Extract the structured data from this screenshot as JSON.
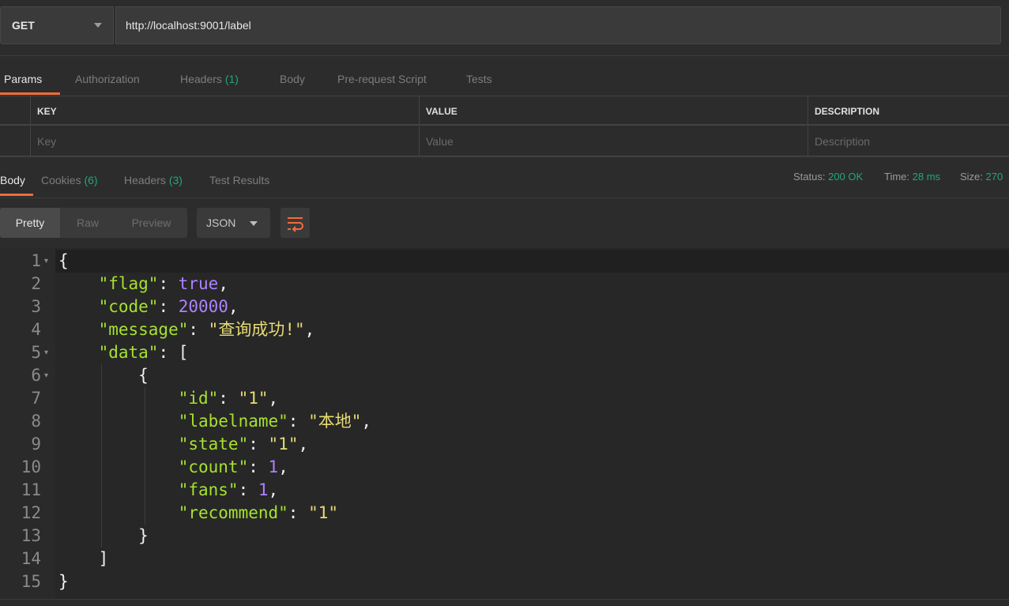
{
  "request": {
    "method": "GET",
    "url": "http://localhost:9001/label"
  },
  "request_tabs": [
    {
      "label": "Params",
      "count": ""
    },
    {
      "label": "Authorization",
      "count": ""
    },
    {
      "label": "Headers",
      "count": "(1)"
    },
    {
      "label": "Body",
      "count": ""
    },
    {
      "label": "Pre-request Script",
      "count": ""
    },
    {
      "label": "Tests",
      "count": ""
    }
  ],
  "params_table": {
    "headers": [
      "KEY",
      "VALUE",
      "DESCRIPTION"
    ],
    "placeholders": [
      "Key",
      "Value",
      "Description"
    ]
  },
  "response_tabs": [
    {
      "label": "Body",
      "count": ""
    },
    {
      "label": "Cookies",
      "count": "(6)"
    },
    {
      "label": "Headers",
      "count": "(3)"
    },
    {
      "label": "Test Results",
      "count": ""
    }
  ],
  "status": {
    "status_label": "Status:",
    "status_value": "200 OK",
    "time_label": "Time:",
    "time_value": "28 ms",
    "size_label": "Size:",
    "size_value": "270"
  },
  "view_modes": [
    "Pretty",
    "Raw",
    "Preview"
  ],
  "format": "JSON",
  "icons": {
    "method_dropdown": "chevron-down-icon",
    "format_dropdown": "chevron-down-icon",
    "wrap": "wrap-lines-icon"
  },
  "colors": {
    "accent": "#f26b3a",
    "success": "#21a876",
    "json_key": "#a6e22e",
    "json_string": "#e6db74",
    "json_number": "#ae81ff"
  },
  "editor": {
    "line_numbers": [
      "1",
      "2",
      "3",
      "4",
      "5",
      "6",
      "7",
      "8",
      "9",
      "10",
      "11",
      "12",
      "13",
      "14",
      "15"
    ],
    "lines": [
      [
        {
          "t": "p",
          "v": "{"
        }
      ],
      [
        {
          "t": "p",
          "v": "    "
        },
        {
          "t": "k",
          "v": "\"flag\""
        },
        {
          "t": "p",
          "v": ": "
        },
        {
          "t": "n",
          "v": "true"
        },
        {
          "t": "p",
          "v": ","
        }
      ],
      [
        {
          "t": "p",
          "v": "    "
        },
        {
          "t": "k",
          "v": "\"code\""
        },
        {
          "t": "p",
          "v": ": "
        },
        {
          "t": "n",
          "v": "20000"
        },
        {
          "t": "p",
          "v": ","
        }
      ],
      [
        {
          "t": "p",
          "v": "    "
        },
        {
          "t": "k",
          "v": "\"message\""
        },
        {
          "t": "p",
          "v": ": "
        },
        {
          "t": "s",
          "v": "\"查询成功!\""
        },
        {
          "t": "p",
          "v": ","
        }
      ],
      [
        {
          "t": "p",
          "v": "    "
        },
        {
          "t": "k",
          "v": "\"data\""
        },
        {
          "t": "p",
          "v": ": ["
        }
      ],
      [
        {
          "t": "p",
          "v": "        {"
        }
      ],
      [
        {
          "t": "p",
          "v": "            "
        },
        {
          "t": "k",
          "v": "\"id\""
        },
        {
          "t": "p",
          "v": ": "
        },
        {
          "t": "s",
          "v": "\"1\""
        },
        {
          "t": "p",
          "v": ","
        }
      ],
      [
        {
          "t": "p",
          "v": "            "
        },
        {
          "t": "k",
          "v": "\"labelname\""
        },
        {
          "t": "p",
          "v": ": "
        },
        {
          "t": "s",
          "v": "\"本地\""
        },
        {
          "t": "p",
          "v": ","
        }
      ],
      [
        {
          "t": "p",
          "v": "            "
        },
        {
          "t": "k",
          "v": "\"state\""
        },
        {
          "t": "p",
          "v": ": "
        },
        {
          "t": "s",
          "v": "\"1\""
        },
        {
          "t": "p",
          "v": ","
        }
      ],
      [
        {
          "t": "p",
          "v": "            "
        },
        {
          "t": "k",
          "v": "\"count\""
        },
        {
          "t": "p",
          "v": ": "
        },
        {
          "t": "n",
          "v": "1"
        },
        {
          "t": "p",
          "v": ","
        }
      ],
      [
        {
          "t": "p",
          "v": "            "
        },
        {
          "t": "k",
          "v": "\"fans\""
        },
        {
          "t": "p",
          "v": ": "
        },
        {
          "t": "n",
          "v": "1"
        },
        {
          "t": "p",
          "v": ","
        }
      ],
      [
        {
          "t": "p",
          "v": "            "
        },
        {
          "t": "k",
          "v": "\"recommend\""
        },
        {
          "t": "p",
          "v": ": "
        },
        {
          "t": "s",
          "v": "\"1\""
        }
      ],
      [
        {
          "t": "p",
          "v": "        }"
        }
      ],
      [
        {
          "t": "p",
          "v": "    ]"
        }
      ],
      [
        {
          "t": "p",
          "v": "}"
        }
      ]
    ]
  }
}
